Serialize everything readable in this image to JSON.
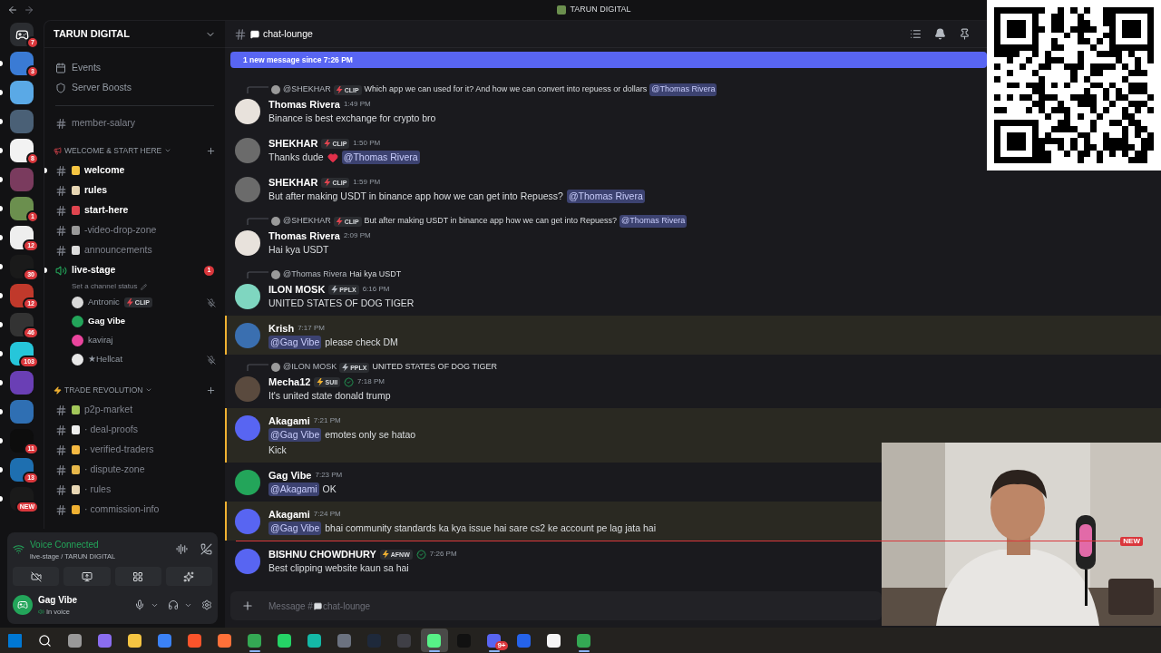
{
  "titlebar": {
    "title": "TARUN DIGITAL"
  },
  "servers": [
    {
      "unread": false,
      "badge": "7"
    },
    {
      "unread": true,
      "badge": "3"
    },
    {
      "unread": true
    },
    {
      "unread": true
    },
    {
      "unread": true,
      "badge": "8"
    },
    {
      "unread": true
    },
    {
      "unread": true,
      "badge": "1"
    },
    {
      "unread": true,
      "badge": "12"
    },
    {
      "unread": true,
      "badge": "30"
    },
    {
      "unread": true,
      "badge": "12"
    },
    {
      "unread": true,
      "badge": "46"
    },
    {
      "unread": true,
      "badge": "103"
    },
    {
      "unread": true
    },
    {
      "unread": true
    },
    {
      "unread": true,
      "badge": "11"
    },
    {
      "unread": true,
      "badge": "13"
    },
    {
      "unread": true,
      "badge": "NEW"
    }
  ],
  "sidebar": {
    "server_name": "TARUN DIGITAL",
    "shortcuts": [
      {
        "label": "Events"
      },
      {
        "label": "Server Boosts"
      }
    ],
    "top_channels": [
      {
        "name": "member-salary",
        "unread": false
      }
    ],
    "categories": [
      {
        "name": "WELCOME & START HERE",
        "channels": [
          {
            "kind": "text",
            "name": "welcome",
            "unread": true,
            "dot": true
          },
          {
            "kind": "text",
            "name": "rules",
            "unread": true,
            "dot": false
          },
          {
            "kind": "text",
            "name": "start-here",
            "unread": true,
            "dot": false
          },
          {
            "kind": "text",
            "name": "-video-drop-zone",
            "unread": false,
            "dot": false
          },
          {
            "kind": "text",
            "name": "announcements",
            "unread": false,
            "dot": false
          },
          {
            "kind": "voice",
            "name": "live-stage",
            "unread": true,
            "dot": true,
            "badge": "1",
            "status": "Set a channel status",
            "members": [
              {
                "name": "Antronic",
                "tag": {
                  "text": "CLIP",
                  "color": "#e0454f"
                },
                "active": false,
                "muted": true,
                "color": "#d9d9d9"
              },
              {
                "name": "Gag Vibe",
                "active": true,
                "muted": false,
                "color": "#23a55a"
              },
              {
                "name": "kaviraj",
                "active": false,
                "muted": false,
                "color": "#eb459e"
              },
              {
                "name": "★Hellcat",
                "active": false,
                "muted": true,
                "color": "#e8e8e8"
              }
            ]
          }
        ]
      },
      {
        "name": "TRADE REVOLUTION",
        "channels": [
          {
            "kind": "text",
            "name": "p2p-market",
            "unread": false,
            "dot": false
          },
          {
            "kind": "text",
            "name": "· deal-proofs",
            "unread": false,
            "dot": false
          },
          {
            "kind": "text",
            "name": "· verified-traders",
            "unread": false,
            "dot": false
          },
          {
            "kind": "text",
            "name": "· dispute-zone",
            "unread": false,
            "dot": false
          },
          {
            "kind": "text",
            "name": "· rules",
            "unread": false,
            "dot": false
          },
          {
            "kind": "text",
            "name": "· commission-info",
            "unread": false,
            "dot": false
          }
        ]
      }
    ]
  },
  "voice_panel": {
    "status": "Voice Connected",
    "location": "live-stage / TARUN DIGITAL",
    "user": {
      "name": "Gag Vibe",
      "status": "In voice"
    }
  },
  "chat": {
    "channel": "chat-lounge",
    "banner": "1 new message since 7:26 PM",
    "messages": [
      {
        "reply": {
          "author": "@SHEKHAR",
          "tag": {
            "text": "CLIP",
            "color": "#e0454f"
          },
          "text": "Which app we can used for it? And how we can convert into repuess or dollars",
          "mention": "@Thomas Rivera"
        },
        "author": "Thomas Rivera",
        "color": "#e8e2dc",
        "verified": false,
        "time": "1:49 PM",
        "mentioned": false,
        "lines": [
          [
            {
              "kind": "text",
              "text": "Binance is best exchange for crypto bro"
            }
          ]
        ]
      },
      {
        "author": "SHEKHAR",
        "tag": {
          "text": "CLIP",
          "color": "#e0454f"
        },
        "color": "#6b6b6b",
        "verified": false,
        "time": "1:50 PM",
        "mentioned": false,
        "lines": [
          [
            {
              "kind": "text",
              "text": "Thanks dude"
            },
            {
              "kind": "heart"
            },
            {
              "kind": "mention",
              "text": "@Thomas Rivera"
            }
          ]
        ]
      },
      {
        "author": "SHEKHAR",
        "tag": {
          "text": "CLIP",
          "color": "#e0454f"
        },
        "color": "#6b6b6b",
        "verified": false,
        "time": "1:59 PM",
        "mentioned": false,
        "lines": [
          [
            {
              "kind": "text",
              "text": "But after making USDT in binance app how we can get into Repuess?"
            },
            {
              "kind": "mention",
              "text": "@Thomas Rivera"
            }
          ]
        ]
      },
      {
        "reply": {
          "author": "@SHEKHAR",
          "tag": {
            "text": "CLIP",
            "color": "#e0454f"
          },
          "text": "But after making USDT in binance app how we can get into Repuess?",
          "mention": "@Thomas Rivera"
        },
        "author": "Thomas Rivera",
        "color": "#e8e2dc",
        "verified": false,
        "time": "2:09 PM",
        "mentioned": false,
        "lines": [
          [
            {
              "kind": "text",
              "text": "Hai kya USDT"
            }
          ]
        ]
      },
      {
        "reply": {
          "author": "@Thomas Rivera",
          "text": "Hai kya USDT"
        },
        "author": "ILON MOSK",
        "tag": {
          "text": "PPLX",
          "color": "#b5bac1"
        },
        "color": "#7fd6c0",
        "verified": false,
        "time": "6:16 PM",
        "mentioned": false,
        "lines": [
          [
            {
              "kind": "text",
              "text": "UNITED STATES OF DOG TIGER"
            }
          ]
        ]
      },
      {
        "author": "Krish",
        "color": "#3a6fb0",
        "verified": false,
        "time": "7:17 PM",
        "mentioned": true,
        "lines": [
          [
            {
              "kind": "mention",
              "text": "@Gag Vibe"
            },
            {
              "kind": "text",
              "text": "please check DM"
            }
          ]
        ]
      },
      {
        "reply": {
          "author": "@ILON MOSK",
          "tag": {
            "text": "PPLX",
            "color": "#b5bac1"
          },
          "text": "UNITED STATES OF DOG TIGER"
        },
        "author": "Mecha12",
        "tag": {
          "text": "SUII",
          "color": "#f0b132"
        },
        "color": "#5a4a3e",
        "verified": true,
        "time": "7:18 PM",
        "mentioned": false,
        "lines": [
          [
            {
              "kind": "text",
              "text": "It's united state  donald trump"
            }
          ]
        ]
      },
      {
        "author": "Akagami",
        "color": "#5865f2",
        "verified": false,
        "time": "7:21 PM",
        "mentioned": true,
        "lines": [
          [
            {
              "kind": "mention",
              "text": "@Gag Vibe"
            },
            {
              "kind": "text",
              "text": "emotes only se hatao"
            }
          ],
          [
            {
              "kind": "text",
              "text": "Kick"
            }
          ]
        ]
      },
      {
        "author": "Gag Vibe",
        "color": "#23a55a",
        "verified": false,
        "time": "7:23 PM",
        "mentioned": false,
        "lines": [
          [
            {
              "kind": "mention",
              "text": "@Akagami"
            },
            {
              "kind": "text",
              "text": "OK"
            }
          ]
        ]
      },
      {
        "author": "Akagami",
        "color": "#5865f2",
        "verified": false,
        "time": "7:24 PM",
        "mentioned": true,
        "lines": [
          [
            {
              "kind": "mention",
              "text": "@Gag Vibe"
            },
            {
              "kind": "text",
              "text": "bhai community standards ka kya issue hai sare cs2 ke account pe lag jata hai"
            }
          ]
        ]
      },
      {
        "kind": "divider",
        "label": "NEW"
      },
      {
        "author": "BISHNU CHOWDHURY",
        "tag": {
          "text": "AFNW",
          "color": "#f0b132"
        },
        "color": "#5865f2",
        "verified": true,
        "time": "7:26 PM",
        "mentioned": false,
        "lines": [
          [
            {
              "kind": "text",
              "text": "Best clipping website kaun sa hai"
            }
          ]
        ]
      }
    ],
    "composer": {
      "hint_prefix": "Message #",
      "hint_channel": "chat-lounge"
    }
  },
  "taskbar": {
    "apps": [
      {
        "selected": false,
        "running": false
      },
      {
        "selected": false,
        "running": false
      },
      {
        "selected": false,
        "running": false
      },
      {
        "selected": false,
        "running": false
      },
      {
        "selected": false,
        "running": false
      },
      {
        "selected": false,
        "running": false
      },
      {
        "selected": false,
        "running": false
      },
      {
        "selected": false,
        "running": false
      },
      {
        "selected": false,
        "running": true
      },
      {
        "selected": false,
        "running": false
      },
      {
        "selected": false,
        "running": false
      },
      {
        "selected": false,
        "running": false
      },
      {
        "selected": false,
        "running": false
      },
      {
        "selected": false,
        "running": false
      },
      {
        "selected": true,
        "running": true
      },
      {
        "selected": false,
        "running": false
      },
      {
        "selected": false,
        "running": true,
        "badge": "9+"
      },
      {
        "selected": false,
        "running": false
      },
      {
        "selected": false,
        "running": false
      },
      {
        "selected": false,
        "running": true
      }
    ]
  }
}
